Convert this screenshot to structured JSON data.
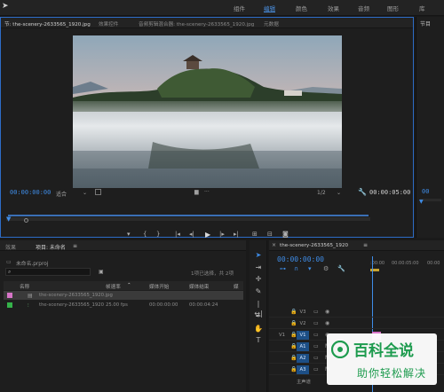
{
  "workspace_tabs": [
    "组件",
    "编辑",
    "颜色",
    "效果",
    "音频",
    "图形",
    "库"
  ],
  "workspace_active": "编辑",
  "monitor": {
    "tabs": [
      "节: the-scenery-2633565_1920.jpg",
      "效果控件",
      "音频剪辑混合器: the-scenery-2633565_1920.jpg",
      "元数据"
    ],
    "timecode_left": "00:00:00:00",
    "fit_label": "适合",
    "resolution_label": "1/2",
    "timecode_right": "00:00:05:00"
  },
  "right_panel": {
    "tab": "节目",
    "timecode": "00"
  },
  "project": {
    "tabs": [
      "效果",
      "项目: 未命名"
    ],
    "project_file": "未命名.prproj",
    "selection_info": "1项已选择，共 2项",
    "columns": [
      "名称",
      "帧速率",
      "媒体开始",
      "媒体结束",
      "媒"
    ],
    "rows": [
      {
        "name": "the-scenery-2633565_1920.jpg",
        "fps": "",
        "start": "",
        "end": "",
        "color": "#d774c8"
      },
      {
        "name": "the-scenery-2633565_1920",
        "fps": "25.00 fps",
        "start": "00:00:00:00",
        "end": "00:00:04:24",
        "color": "#35b24a"
      }
    ]
  },
  "timeline": {
    "sequence_name": "the-scenery-2633565_1920",
    "timecode": "00:00:00:00",
    "ruler": [
      ":00:00",
      "00:00:05:00",
      "00:00"
    ],
    "tracks": [
      {
        "name": "V3",
        "video": true
      },
      {
        "name": "V2",
        "video": true
      },
      {
        "name": "V1",
        "video": true,
        "active": true
      },
      {
        "name": "A1",
        "video": false,
        "active": true
      },
      {
        "name": "A2",
        "video": false,
        "active": true
      },
      {
        "name": "A3",
        "video": false,
        "active": true
      }
    ],
    "master_label": "主声道",
    "v1_label": "V1"
  },
  "watermark": {
    "title": "百科全说",
    "subtitle": "助你轻松解决"
  }
}
